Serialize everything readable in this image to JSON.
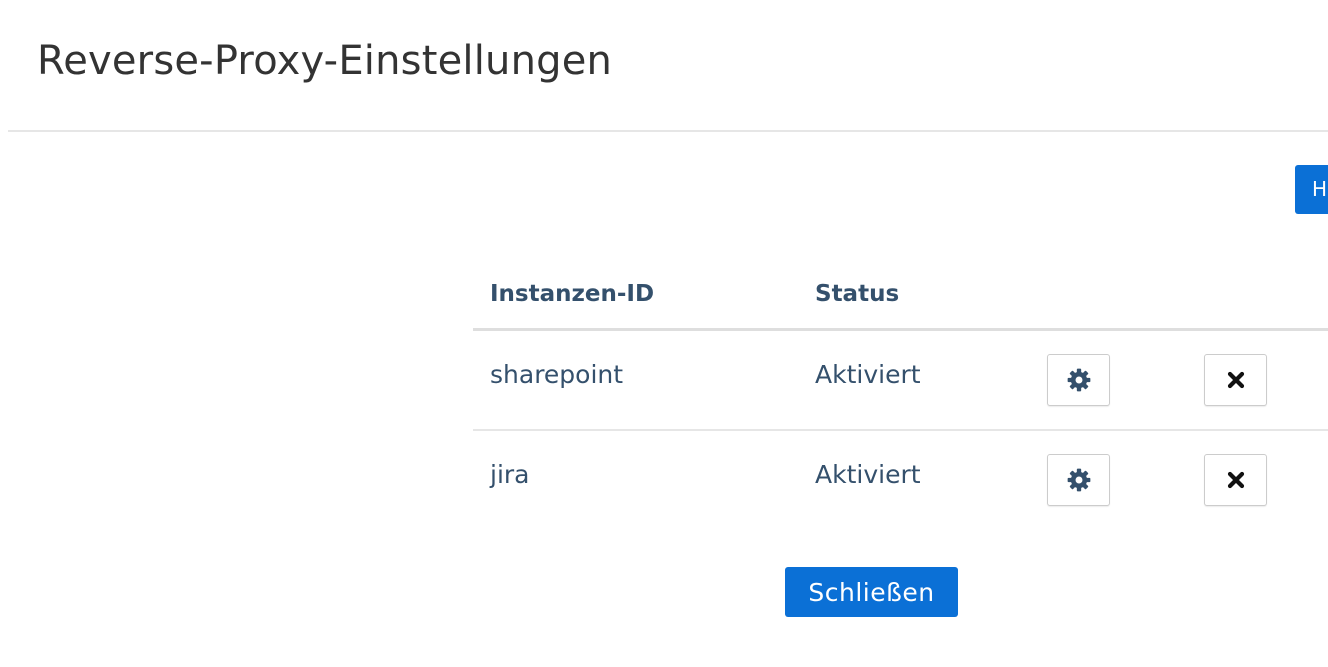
{
  "dialog": {
    "title": "Reverse-Proxy-Einstellungen",
    "add_button_label": "H",
    "table": {
      "headers": {
        "instance_id": "Instanzen-ID",
        "status": "Status"
      },
      "rows": [
        {
          "instance_id": "sharepoint",
          "status": "Aktiviert"
        },
        {
          "instance_id": "jira",
          "status": "Aktiviert"
        }
      ]
    },
    "close_button_label": "Schließen"
  },
  "icons": {
    "settings": "gear-icon",
    "delete": "close-icon"
  },
  "colors": {
    "primary": "#0b70d6",
    "text_link": "#34506c",
    "title": "#333333",
    "divider": "#e6e6e6"
  }
}
